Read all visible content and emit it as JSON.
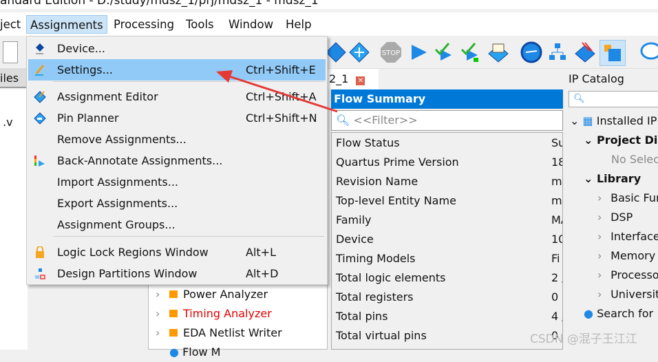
{
  "window": {
    "title": "andard Edition - D:/study/mdsz_1/prj/mdsz_1 - mdsz_1"
  },
  "menubar": {
    "items": [
      {
        "label": "ject"
      },
      {
        "label": "Assignments"
      },
      {
        "label": "Processing"
      },
      {
        "label": "Tools"
      },
      {
        "label": "Window"
      },
      {
        "label": "Help"
      }
    ]
  },
  "assignments_menu": {
    "items": [
      {
        "label": "Device...",
        "shortcut": "",
        "icon": "device-icon"
      },
      {
        "label": "Settings...",
        "shortcut": "Ctrl+Shift+E",
        "icon": "settings-icon"
      },
      {
        "label": "Assignment Editor",
        "shortcut": "Ctrl+Shift+A",
        "icon": "assignment-editor-icon"
      },
      {
        "label": "Pin Planner",
        "shortcut": "Ctrl+Shift+N",
        "icon": "pin-planner-icon"
      },
      {
        "label": "Remove Assignments...",
        "shortcut": ""
      },
      {
        "label": "Back-Annotate Assignments...",
        "shortcut": "",
        "icon": "back-annotate-icon"
      },
      {
        "label": "Import Assignments...",
        "shortcut": ""
      },
      {
        "label": "Export Assignments...",
        "shortcut": ""
      },
      {
        "label": "Assignment Groups...",
        "shortcut": ""
      },
      {
        "label": "Logic Lock Regions Window",
        "shortcut": "Alt+L",
        "icon": "lock-icon"
      },
      {
        "label": "Design Partitions Window",
        "shortcut": "Alt+D",
        "icon": "partitions-icon"
      }
    ]
  },
  "left_panel": {
    "tab": "iles",
    "file": ".v"
  },
  "tasks": {
    "items": [
      {
        "label": "Power Analyzer"
      },
      {
        "label": "Timing Analyzer",
        "color": "#e00000"
      },
      {
        "label": "EDA Netlist Writer"
      },
      {
        "label": "Flow M"
      }
    ]
  },
  "doc_tab": {
    "label": "2_1"
  },
  "flow_summary": {
    "title": "Flow Summary",
    "filter_placeholder": "<<Filter>>",
    "rows": [
      {
        "name": "Flow Status",
        "value": "Su"
      },
      {
        "name": "Quartus Prime Version",
        "value": "18"
      },
      {
        "name": "Revision Name",
        "value": "m"
      },
      {
        "name": "Top-level Entity Name",
        "value": "m"
      },
      {
        "name": "Family",
        "value": "MA"
      },
      {
        "name": "Device",
        "value": "10"
      },
      {
        "name": "Timing Models",
        "value": "Fi"
      },
      {
        "name": "Total logic elements",
        "value": "2 /"
      },
      {
        "name": "Total registers",
        "value": "0"
      },
      {
        "name": "Total pins",
        "value": "4 /"
      },
      {
        "name": "Total virtual pins",
        "value": "0"
      }
    ]
  },
  "ip_catalog": {
    "title": "IP Catalog",
    "installed": "Installed IP",
    "project_dir": "Project Dir",
    "no_selection": "No Selec",
    "library": "Library",
    "categories": [
      "Basic Fun",
      "DSP",
      "Interface",
      "Memory",
      "Processo",
      "Universit"
    ],
    "search": "Search for"
  },
  "watermark": "CSDN @混子王江江",
  "colors": {
    "accent": "#0078d7",
    "highlight": "#91c9f7",
    "arrow": "#e53935"
  }
}
